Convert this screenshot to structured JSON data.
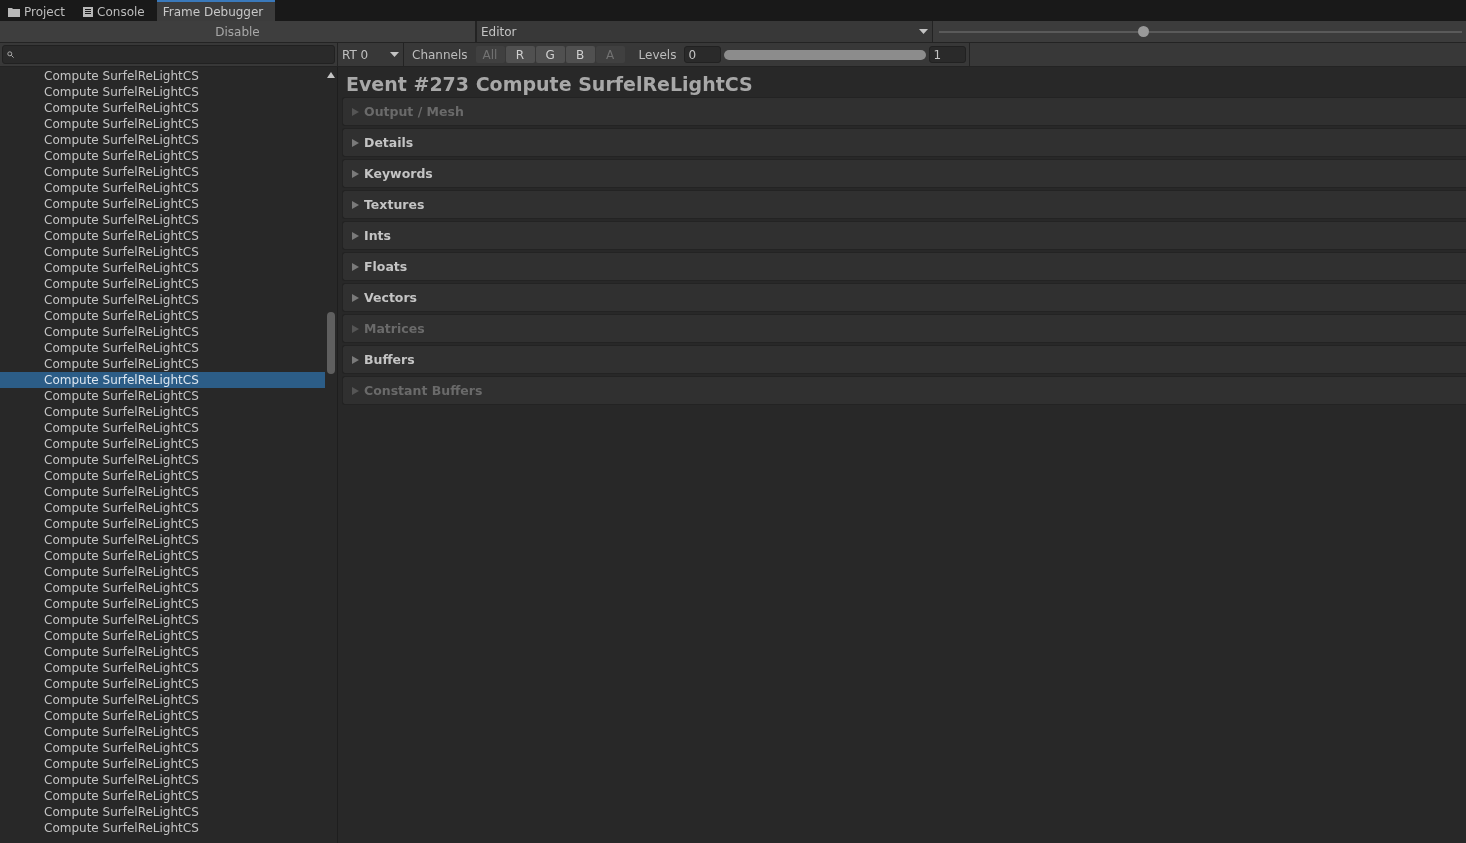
{
  "tabs": [
    {
      "label": "Project",
      "kind": "folder",
      "selected": false
    },
    {
      "label": "Console",
      "kind": "console",
      "selected": false
    },
    {
      "label": "Frame Debugger",
      "kind": "plain",
      "selected": true
    }
  ],
  "toolbar": {
    "disable_button": "Disable",
    "target_dropdown": "Editor",
    "event_slider": {
      "level": 0.39
    }
  },
  "events": [
    {
      "label": "Compute SurfelReLightCS",
      "selected": false
    },
    {
      "label": "Compute SurfelReLightCS",
      "selected": false
    },
    {
      "label": "Compute SurfelReLightCS",
      "selected": false
    },
    {
      "label": "Compute SurfelReLightCS",
      "selected": false
    },
    {
      "label": "Compute SurfelReLightCS",
      "selected": false
    },
    {
      "label": "Compute SurfelReLightCS",
      "selected": false
    },
    {
      "label": "Compute SurfelReLightCS",
      "selected": false
    },
    {
      "label": "Compute SurfelReLightCS",
      "selected": false
    },
    {
      "label": "Compute SurfelReLightCS",
      "selected": false
    },
    {
      "label": "Compute SurfelReLightCS",
      "selected": false
    },
    {
      "label": "Compute SurfelReLightCS",
      "selected": false
    },
    {
      "label": "Compute SurfelReLightCS",
      "selected": false
    },
    {
      "label": "Compute SurfelReLightCS",
      "selected": false
    },
    {
      "label": "Compute SurfelReLightCS",
      "selected": false
    },
    {
      "label": "Compute SurfelReLightCS",
      "selected": false
    },
    {
      "label": "Compute SurfelReLightCS",
      "selected": false
    },
    {
      "label": "Compute SurfelReLightCS",
      "selected": false
    },
    {
      "label": "Compute SurfelReLightCS",
      "selected": false
    },
    {
      "label": "Compute SurfelReLightCS",
      "selected": false
    },
    {
      "label": "Compute SurfelReLightCS",
      "selected": true
    },
    {
      "label": "Compute SurfelReLightCS",
      "selected": false
    },
    {
      "label": "Compute SurfelReLightCS",
      "selected": false
    },
    {
      "label": "Compute SurfelReLightCS",
      "selected": false
    },
    {
      "label": "Compute SurfelReLightCS",
      "selected": false
    },
    {
      "label": "Compute SurfelReLightCS",
      "selected": false
    },
    {
      "label": "Compute SurfelReLightCS",
      "selected": false
    },
    {
      "label": "Compute SurfelReLightCS",
      "selected": false
    },
    {
      "label": "Compute SurfelReLightCS",
      "selected": false
    },
    {
      "label": "Compute SurfelReLightCS",
      "selected": false
    },
    {
      "label": "Compute SurfelReLightCS",
      "selected": false
    },
    {
      "label": "Compute SurfelReLightCS",
      "selected": false
    },
    {
      "label": "Compute SurfelReLightCS",
      "selected": false
    },
    {
      "label": "Compute SurfelReLightCS",
      "selected": false
    },
    {
      "label": "Compute SurfelReLightCS",
      "selected": false
    },
    {
      "label": "Compute SurfelReLightCS",
      "selected": false
    },
    {
      "label": "Compute SurfelReLightCS",
      "selected": false
    },
    {
      "label": "Compute SurfelReLightCS",
      "selected": false
    },
    {
      "label": "Compute SurfelReLightCS",
      "selected": false
    },
    {
      "label": "Compute SurfelReLightCS",
      "selected": false
    },
    {
      "label": "Compute SurfelReLightCS",
      "selected": false
    },
    {
      "label": "Compute SurfelReLightCS",
      "selected": false
    },
    {
      "label": "Compute SurfelReLightCS",
      "selected": false
    },
    {
      "label": "Compute SurfelReLightCS",
      "selected": false
    },
    {
      "label": "Compute SurfelReLightCS",
      "selected": false
    },
    {
      "label": "Compute SurfelReLightCS",
      "selected": false
    },
    {
      "label": "Compute SurfelReLightCS",
      "selected": false
    },
    {
      "label": "Compute SurfelReLightCS",
      "selected": false
    },
    {
      "label": "Compute SurfelReLightCS",
      "selected": false
    }
  ],
  "viewer_bar": {
    "rt_dropdown": "RT 0",
    "channels_label": "Channels",
    "channels": [
      {
        "label": "All",
        "on": false
      },
      {
        "label": "R",
        "on": true
      },
      {
        "label": "G",
        "on": true
      },
      {
        "label": "B",
        "on": true
      },
      {
        "label": "A",
        "on": false
      }
    ],
    "levels_label": "Levels",
    "levels_min": "0",
    "levels_range": {
      "level": 1
    },
    "levels_max": "1"
  },
  "event_title": "Event #273 Compute SurfelReLightCS",
  "sections": [
    {
      "label": "Output / Mesh",
      "disabled": true,
      "expanded": false
    },
    {
      "label": "Details",
      "disabled": false,
      "expanded": false
    },
    {
      "label": "Keywords",
      "disabled": false,
      "expanded": false
    },
    {
      "label": "Textures",
      "disabled": false,
      "expanded": false
    },
    {
      "label": "Ints",
      "disabled": false,
      "expanded": false
    },
    {
      "label": "Floats",
      "disabled": false,
      "expanded": false
    },
    {
      "label": "Vectors",
      "disabled": false,
      "expanded": false
    },
    {
      "label": "Matrices",
      "disabled": true,
      "expanded": false
    },
    {
      "label": "Buffers",
      "disabled": false,
      "expanded": false
    },
    {
      "label": "Constant Buffers",
      "disabled": true,
      "expanded": false
    }
  ]
}
